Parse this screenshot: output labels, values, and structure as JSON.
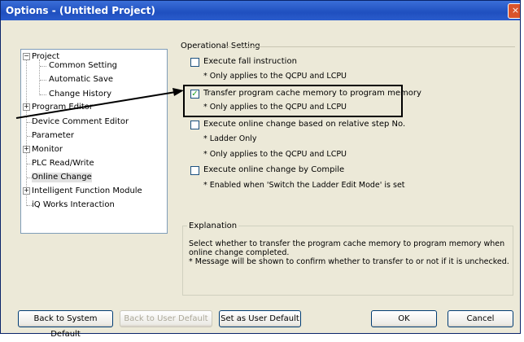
{
  "window": {
    "title": "Options - (Untitled Project)",
    "close_glyph": "×"
  },
  "tree": {
    "items": [
      {
        "label": "Project",
        "expander": "−"
      },
      {
        "label": "Common Setting"
      },
      {
        "label": "Automatic Save"
      },
      {
        "label": "Change History"
      },
      {
        "label": "Program Editor",
        "expander": "+"
      },
      {
        "label": "Device Comment Editor"
      },
      {
        "label": "Parameter"
      },
      {
        "label": "Monitor",
        "expander": "+"
      },
      {
        "label": "PLC Read/Write"
      },
      {
        "label": "Online Change",
        "selected": true
      },
      {
        "label": "Intelligent Function Module",
        "expander": "+"
      },
      {
        "label": "iQ Works Interaction"
      }
    ]
  },
  "settings": {
    "group_label": "Operational Setting",
    "options": [
      {
        "label": "Execute fall instruction",
        "checked": false,
        "notes": [
          "* Only applies to the QCPU and LCPU"
        ]
      },
      {
        "label": "Transfer program cache memory to program memory",
        "checked": true,
        "notes": [
          "* Only applies to the QCPU and LCPU"
        ]
      },
      {
        "label": "Execute online change based on relative step No.",
        "checked": false,
        "notes": [
          "* Ladder Only",
          "* Only applies to the QCPU and LCPU"
        ]
      },
      {
        "label": "Execute online change by Compile",
        "checked": false,
        "notes": [
          "* Enabled when 'Switch the Ladder Edit Mode' is set"
        ]
      }
    ]
  },
  "explanation": {
    "title": "Explanation",
    "line1": "Select whether to transfer the program cache memory to program memory when",
    "line2": "online change completed.",
    "line3": "* Message will be shown to confirm whether to transfer to or not if it is unchecked."
  },
  "buttons": {
    "back_system": "Back to System Default",
    "back_user": "Back to User Default",
    "set_user": "Set as User Default",
    "ok": "OK",
    "cancel": "Cancel"
  },
  "colors": {
    "titlebar": "#2a5ccc",
    "dialog_bg": "#ece9d8",
    "check_mark": "#21a121"
  }
}
